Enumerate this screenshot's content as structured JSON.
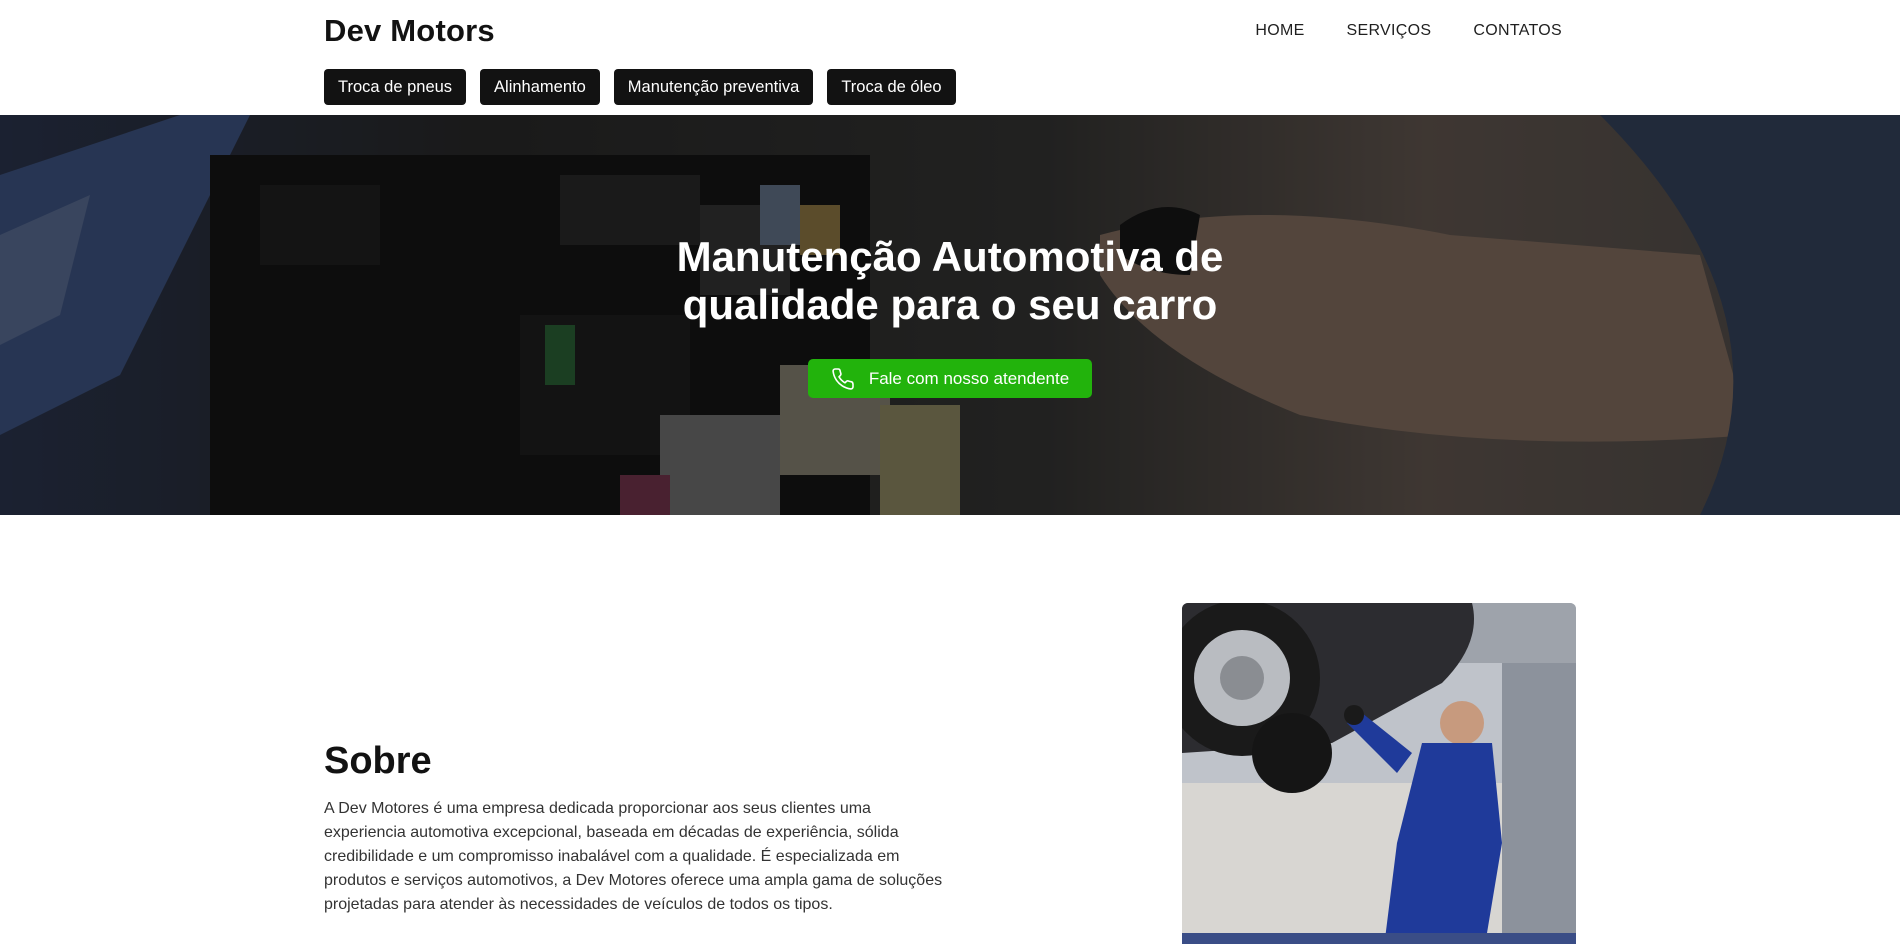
{
  "brand": {
    "logo": "Dev Motors"
  },
  "nav": {
    "items": [
      {
        "label": "HOME"
      },
      {
        "label": "SERVIÇOS"
      },
      {
        "label": "CONTATOS"
      }
    ]
  },
  "service_tabs": [
    {
      "label": "Troca de pneus"
    },
    {
      "label": "Alinhamento"
    },
    {
      "label": "Manutenção preventiva"
    },
    {
      "label": "Troca de óleo"
    }
  ],
  "hero": {
    "title": "Manutenção Automotiva de qualidade para o seu carro",
    "cta_label": "Fale com nosso atendente",
    "cta_icon": "phone-icon"
  },
  "about": {
    "title": "Sobre",
    "description": "A Dev Motores é uma empresa dedicada proporcionar aos seus clientes uma experiencia automotiva excepcional, baseada em décadas de experiência, sólida credibilidade e um compromisso inabalável com a qualidade. É especializada em produtos e serviços automotivos, a Dev Motores oferece uma ampla gama de soluções projetadas para atender às necessidades de veículos de todos os tipos."
  },
  "colors": {
    "accent_green": "#22b30c",
    "tab_background": "#121212",
    "text_dark": "#121212"
  }
}
